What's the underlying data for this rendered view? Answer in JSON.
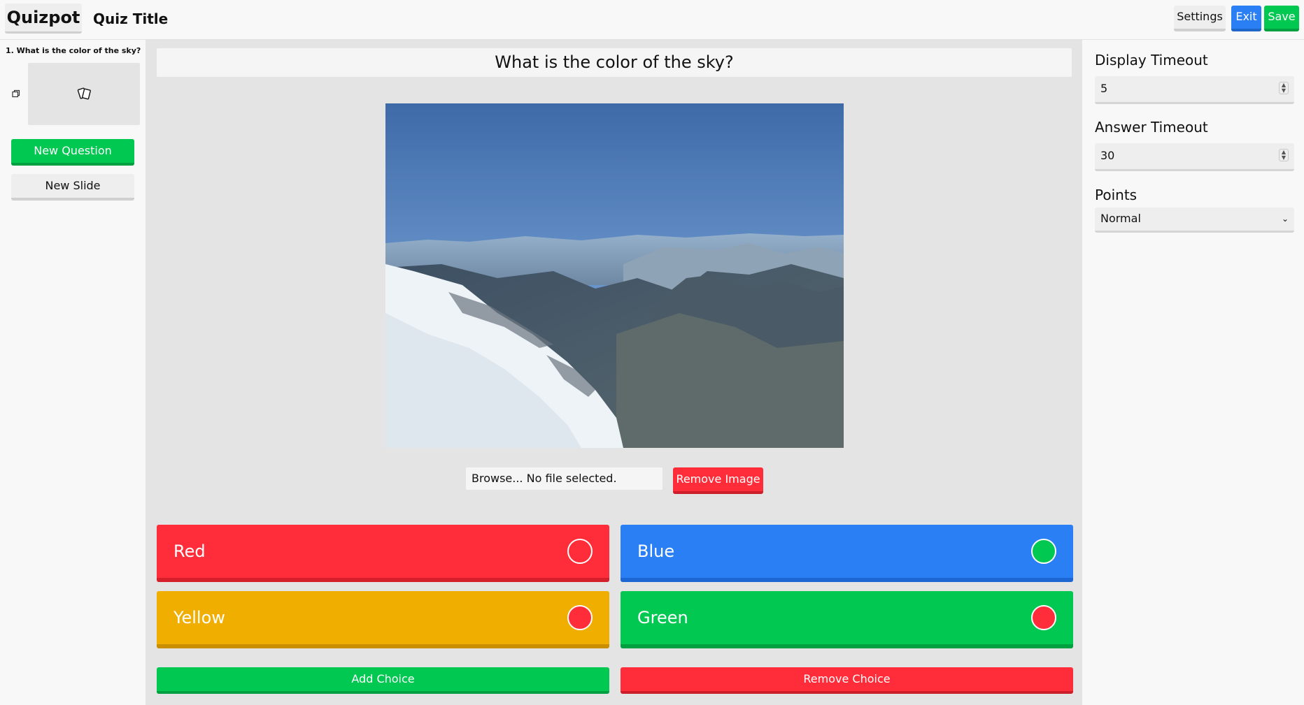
{
  "header": {
    "logo": "Quizpot",
    "quiz_title": "Quiz Title",
    "settings_label": "Settings",
    "exit_label": "Exit",
    "save_label": "Save"
  },
  "sidebar": {
    "slides": [
      {
        "label": "1. What is the color of the sky?"
      }
    ],
    "new_question_label": "New Question",
    "new_slide_label": "New Slide"
  },
  "main": {
    "question_text": "What is the color of the sky?",
    "image_alt": "Aerial view of snowy mountains and a valley under a blue sky",
    "file_input_text": "Browse... No file selected.",
    "remove_image_label": "Remove Image",
    "choices": [
      {
        "text": "Red",
        "color": "#ff2d3a",
        "correct": false
      },
      {
        "text": "Blue",
        "color": "#2b7ff5",
        "correct": true
      },
      {
        "text": "Yellow",
        "color": "#f0ae00",
        "correct": false
      },
      {
        "text": "Green",
        "color": "#00c851",
        "correct": false
      }
    ],
    "add_choice_label": "Add Choice",
    "remove_choice_label": "Remove Choice"
  },
  "panel": {
    "display_timeout_label": "Display Timeout",
    "display_timeout_value": "5",
    "answer_timeout_label": "Answer Timeout",
    "answer_timeout_value": "30",
    "points_label": "Points",
    "points_value": "Normal"
  },
  "colors": {
    "green": "#00c851",
    "blue": "#2b7ff5",
    "red": "#ff2d3a",
    "yellow": "#f0ae00"
  }
}
